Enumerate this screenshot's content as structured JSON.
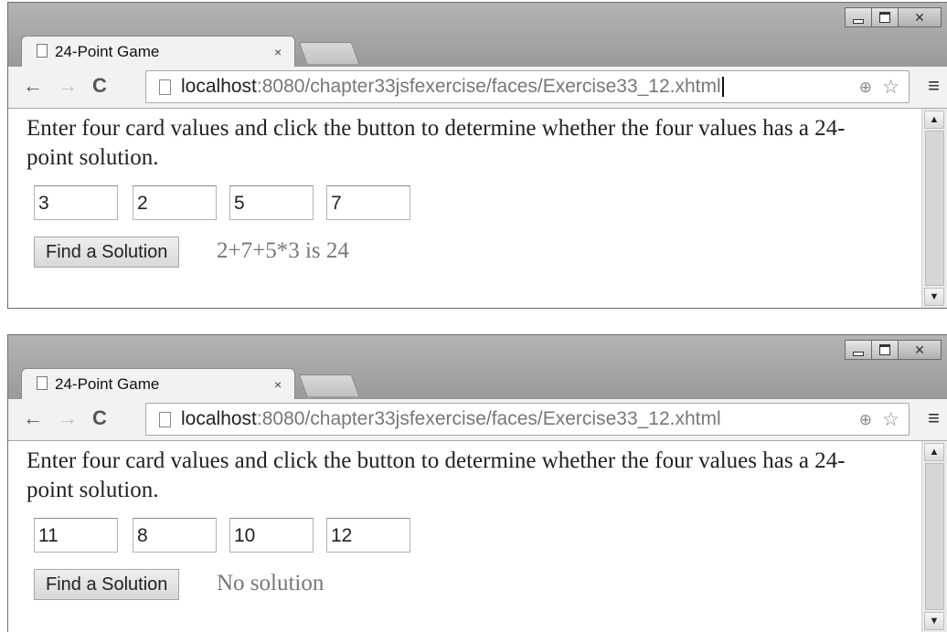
{
  "windows": [
    {
      "tab_title": "24-Point Game",
      "tab_close": "×",
      "url_host": "localhost",
      "url_rest": ":8080/chapter33jsfexercise/faces/Exercise33_12.xhtml",
      "instruction": "Enter four card values and click the button to determine whether the four values has a 24-point solution.",
      "cards": [
        "3",
        "2",
        "5",
        "7"
      ],
      "button_label": "Find a Solution",
      "result": "2+7+5*3 is 24"
    },
    {
      "tab_title": "24-Point Game",
      "tab_close": "×",
      "url_host": "localhost",
      "url_rest": ":8080/chapter33jsfexercise/faces/Exercise33_12.xhtml",
      "instruction": "Enter four card values and click the button to determine whether the four values has a 24-point solution.",
      "cards": [
        "11",
        "8",
        "10",
        "12"
      ],
      "button_label": "Find a Solution",
      "result": "No solution"
    }
  ],
  "icons": {
    "back": "back-arrow-icon",
    "forward": "forward-arrow-icon",
    "reload": "reload-icon",
    "page": "page-icon",
    "zoom": "zoom-icon",
    "bookmark": "star-icon",
    "menu": "menu-icon"
  }
}
